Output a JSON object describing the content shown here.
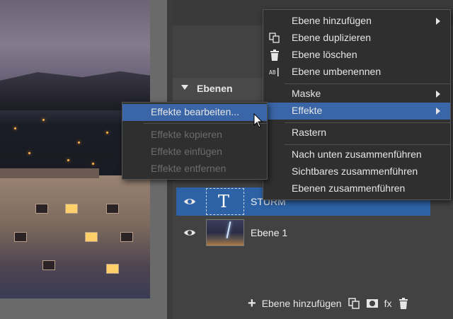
{
  "layers_panel": {
    "header": "Ebenen",
    "layers": [
      {
        "name": "STURM",
        "type": "text",
        "selected": true
      },
      {
        "name": "Ebene 1",
        "type": "image",
        "selected": false
      }
    ]
  },
  "bottom_toolbar": {
    "add_layer_label": "Ebene hinzufügen",
    "fx_label": "fx"
  },
  "context_menu": {
    "items": [
      {
        "label": "Ebene hinzufügen",
        "icon": "",
        "submenu": true
      },
      {
        "label": "Ebene duplizieren",
        "icon": "duplicate-icon"
      },
      {
        "label": "Ebene löschen",
        "icon": "trash-icon"
      },
      {
        "label": "Ebene umbenennen",
        "icon": "rename-icon"
      },
      {
        "label": "Maske",
        "submenu": true
      },
      {
        "label": "Effekte",
        "submenu": true,
        "active": true
      },
      {
        "label": "Rastern"
      },
      {
        "label": "Nach unten zusammenführen"
      },
      {
        "label": "Sichtbares zusammenführen"
      },
      {
        "label": "Ebenen zusammenführen"
      }
    ]
  },
  "effects_submenu": {
    "items": [
      {
        "label": "Effekte bearbeiten...",
        "enabled": true,
        "active": true
      },
      {
        "label": "Effekte kopieren",
        "enabled": false
      },
      {
        "label": "Effekte einfügen",
        "enabled": false
      },
      {
        "label": "Effekte entfernen",
        "enabled": false
      }
    ]
  },
  "colors": {
    "accent": "#2d62a6",
    "menu_bg": "#2f2f2f",
    "menu_active": "#3a66a8",
    "panel_bg": "#424242"
  }
}
